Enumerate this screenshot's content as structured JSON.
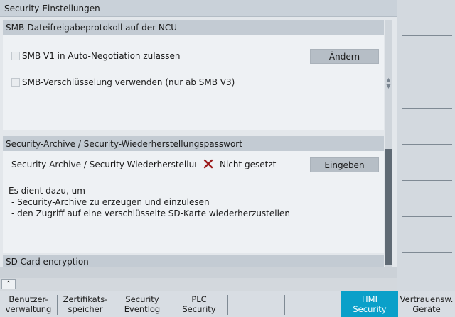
{
  "title": "Security-Einstellungen",
  "smb": {
    "header": "SMB-Dateifreigabeprotokoll auf der NCU",
    "checkbox1": "SMB V1 in Auto-Negotiation zulassen",
    "checkbox2": "SMB-Verschlüsselung verwenden (nur ab SMB V3)",
    "change_button": "Ändern"
  },
  "archive": {
    "header": "Security-Archive / Security-Wiederherstellungspasswort",
    "row_label": "Security-Archive / Security-Wiederherstellungspassw",
    "status_icon": "x-icon",
    "status_text": "Nicht gesetzt",
    "enter_button": "Eingeben",
    "desc1": "Es dient dazu, um",
    "desc2": "- Security-Archive zu erzeugen und einzulesen",
    "desc3": "- den Zugriff auf eine verschlüsselte SD-Karte wiederherzustellen"
  },
  "sdcard": {
    "header": "SD Card encryption"
  },
  "expand_glyph": "⌃",
  "scroll_up_glyph": "▲",
  "scroll_down_glyph": "▼",
  "softkeys": {
    "k1a": "Benutzer-",
    "k1b": "verwaltung",
    "k2a": "Zertifikats-",
    "k2b": "speicher",
    "k3a": "Security",
    "k3b": "Eventlog",
    "k4a": "PLC",
    "k4b": "Security",
    "k7a": "HMI",
    "k7b": "Security",
    "k8a": "Vertrauensw.",
    "k8b": "Geräte"
  },
  "colors": {
    "active_softkey": "#0aa0c9",
    "status_x": "#9b1b1b"
  }
}
